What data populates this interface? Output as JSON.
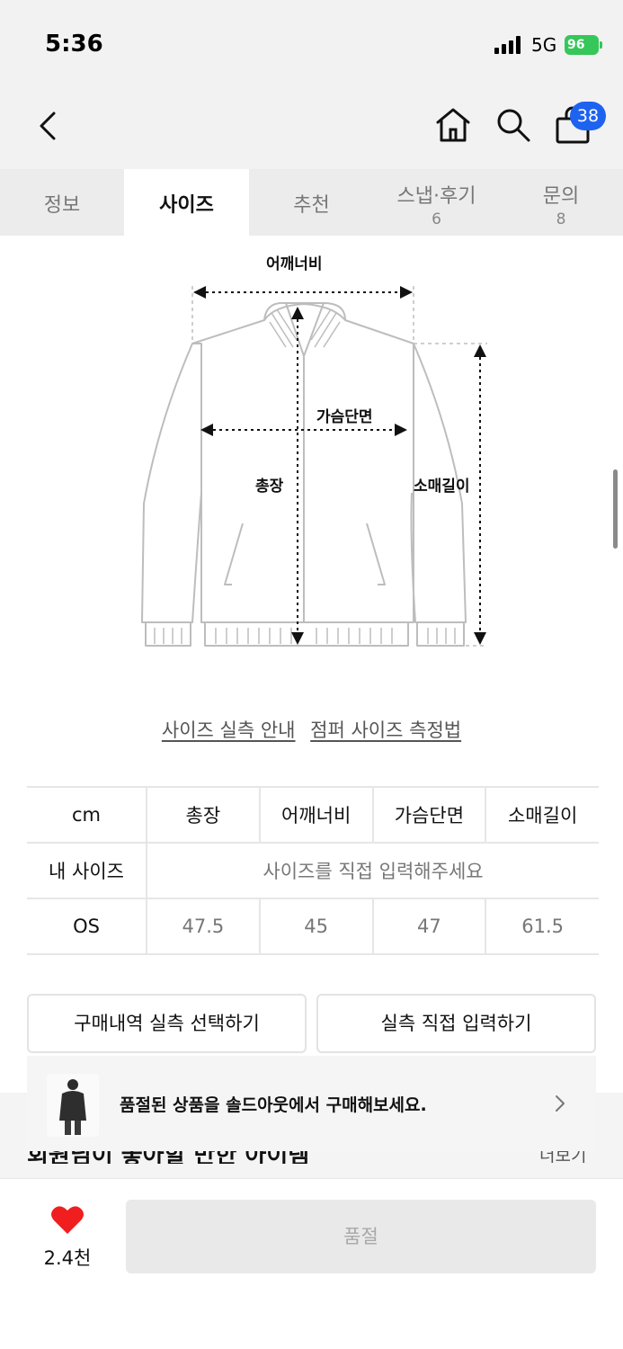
{
  "status": {
    "time": "5:36",
    "network": "5G",
    "battery": "96"
  },
  "nav": {
    "cart_count": "38"
  },
  "tabs": [
    {
      "label": "정보",
      "count": ""
    },
    {
      "label": "사이즈",
      "count": ""
    },
    {
      "label": "추천",
      "count": ""
    },
    {
      "label": "스냅·후기",
      "count": "6"
    },
    {
      "label": "문의",
      "count": "8"
    }
  ],
  "diagram": {
    "shoulder": "어깨너비",
    "chest": "가슴단면",
    "length": "총장",
    "sleeve": "소매길이"
  },
  "guide_links": [
    "사이즈 실측 안내",
    "점퍼 사이즈 측정법"
  ],
  "size_table": {
    "unit": "cm",
    "columns": [
      "총장",
      "어깨너비",
      "가슴단면",
      "소매길이"
    ],
    "my_size_label": "내 사이즈",
    "my_size_msg": "사이즈를 직접 입력해주세요",
    "rows": [
      {
        "label": "OS",
        "values": [
          "47.5",
          "45",
          "47",
          "61.5"
        ]
      }
    ]
  },
  "actions": {
    "select_purchase": "구매내역 실측 선택하기",
    "input_direct": "실측 직접 입력하기"
  },
  "soldout": {
    "message": "품절된 상품을 솔드아웃에서 구매해보세요."
  },
  "peek": {
    "title": "회원님이 좋아할 만한 아이템",
    "more": "더보기"
  },
  "bottom": {
    "likes": "2.4천",
    "buy_label": "품절"
  },
  "colors": {
    "accent_blue": "#1e63f0",
    "heart_red": "#f01e1e",
    "battery_green": "#35c759"
  }
}
